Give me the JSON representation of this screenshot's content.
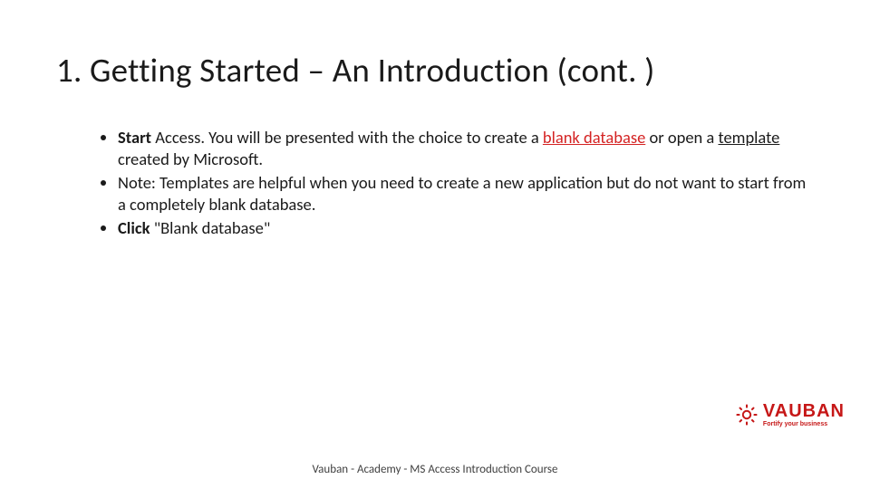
{
  "title": "1. Getting Started – An Introduction (cont. )",
  "bullets": {
    "b1_bold": "Start ",
    "b1_plain1": "Access. You will be presented with the choice to create a ",
    "b1_red_u1": "blank database",
    "b1_plain2": " or open a ",
    "b1_u2": "template",
    "b1_plain3": " created by Microsoft.",
    "b2": "Note: Templates are helpful when you need to create a new application but do not want to start from a completely blank database.",
    "b3_bold": "Click",
    "b3_rest": " \"Blank database\""
  },
  "footer": "Vauban - Academy - MS Access Introduction Course",
  "logo": {
    "name": "VAUBAN",
    "tagline": "Fortify your business"
  }
}
